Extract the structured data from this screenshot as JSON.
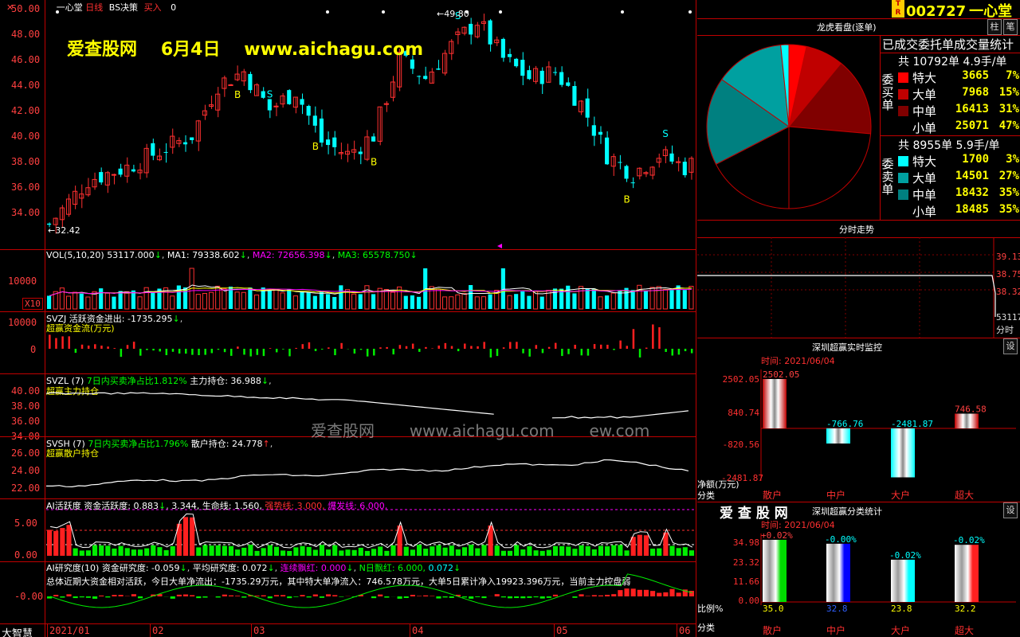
{
  "chart": {
    "stock_name": "一心堂",
    "period": "日线",
    "strategy": "BS决策",
    "signal": "买入",
    "signal_marker": "0",
    "banner_site": "爱查股网",
    "banner_date": "6月4日",
    "banner_url": "www.aichagu.com",
    "high_label": "49.80",
    "low_label": "32.42",
    "price_ticks": [
      "50.00",
      "48.00",
      "46.00",
      "44.00",
      "42.00",
      "40.00",
      "38.00",
      "36.00",
      "34.00"
    ]
  },
  "volume": {
    "header_name": "VOL(5,10,20)",
    "header_vol": "53117.000",
    "ma1": "MA1: 79338.602",
    "ma2": "MA2: 72656.398",
    "ma3": "MA3: 65578.750",
    "tick": "10000",
    "unit": "X10"
  },
  "svzj": {
    "name": "SVZJ",
    "title": "活跃资金进出: -1735.295",
    "subtitle": "超赢资金流(万元)",
    "ticks": [
      "10000",
      "0"
    ]
  },
  "svzl": {
    "name": "SVZL (7)",
    "title": "7日内买卖净占比1.812%",
    "value": "主力持仓: 36.988",
    "subtitle": "超赢主力持仓",
    "ticks": [
      "40.00",
      "38.00",
      "36.00",
      "34.00"
    ]
  },
  "svsh": {
    "name": "SVSH (7)",
    "title": "7日内买卖净占比1.796%",
    "value": "散户持仓: 24.778",
    "subtitle": "超赢散户持仓",
    "ticks": [
      "26.00",
      "24.00",
      "22.00"
    ]
  },
  "ai_active": {
    "title": "AI活跃度",
    "active": "资金活跃度: 0.883",
    "v2": "3.344,",
    "life": "生命线: 1.560,",
    "strong": "强势线: 3.000,",
    "burst": "爆发线: 6.000,",
    "ticks": [
      "5.00",
      "0.00"
    ]
  },
  "ai_research": {
    "title": "AI研究度(10)",
    "research": "资金研究度: -0.059",
    "avg": "平均研究度: 0.072",
    "cont": "连续飘红: 0.000",
    "nday": "N日飘红: 6.000,",
    "last": "0.072",
    "tick": "-0.00",
    "summary": "总体近期大资金相对活跃，今日大单净流出：-1735.29万元，其中特大单净流入：746.578万元，大单5日累计净入19923.396万元，当前主力控盘弱"
  },
  "xaxis": {
    "labels": [
      "2021/01",
      "02",
      "03",
      "04",
      "05",
      "06"
    ],
    "corner": "大智慧"
  },
  "watermark": {
    "site": "爱查股网",
    "url": "www.aichagu.com",
    "tail": "ew.com"
  },
  "right_panel": {
    "code": "002727",
    "name": "一心堂",
    "tab1": "柱",
    "tab2": "笔",
    "lhb_title": "龙虎看盘(逐单)",
    "stats_title": "已成交委托单成交量统计",
    "buy_label": "委买单",
    "sell_label": "委卖单",
    "buy_total": "共 10792单 4.9手/单",
    "sell_total": "共 8955单 5.9手/单",
    "buy_rows": [
      {
        "name": "特大",
        "vol": "3665",
        "pct": "7%",
        "color": "#ff0000"
      },
      {
        "name": "大单",
        "vol": "7968",
        "pct": "15%",
        "color": "#c00000"
      },
      {
        "name": "中单",
        "vol": "16413",
        "pct": "31%",
        "color": "#800000"
      },
      {
        "name": "小单",
        "vol": "25071",
        "pct": "47%",
        "color": "#000000"
      }
    ],
    "sell_rows": [
      {
        "name": "特大",
        "vol": "1700",
        "pct": "3%",
        "color": "#00ffff"
      },
      {
        "name": "大单",
        "vol": "14501",
        "pct": "27%",
        "color": "#00a0a0"
      },
      {
        "name": "中单",
        "vol": "18432",
        "pct": "35%",
        "color": "#008080"
      },
      {
        "name": "小单",
        "vol": "18485",
        "pct": "35%",
        "color": "#000000"
      }
    ],
    "intraday_title": "分时走势",
    "intraday_ticks": [
      "39.13",
      "38.75",
      "38.32",
      "53117",
      "分时"
    ],
    "monitor_title": "深圳超赢实时监控",
    "monitor_btn": "设",
    "monitor_time": "时间: 2021/06/04",
    "monitor_ticks": [
      "2502.05",
      "840.74",
      "-820.56",
      "-2481.87"
    ],
    "monitor_unit": "净额(万元)",
    "monitor_cat": "分类",
    "monitor_bars": [
      {
        "name": "散户",
        "value": "2502.05",
        "num": 2502.05
      },
      {
        "name": "中户",
        "value": "-766.76",
        "num": -766.76
      },
      {
        "name": "大户",
        "value": "-2481.87",
        "num": -2481.87
      },
      {
        "name": "超大",
        "value": "746.58",
        "num": 746.58
      }
    ],
    "class_site": "爱 查 股 网",
    "class_title": "深圳超赢分类统计",
    "class_btn": "设",
    "class_time": "时间: 2021/06/04",
    "class_ticks": [
      "34.98",
      "23.32",
      "11.66",
      "0.00"
    ],
    "class_ratio": "比例%",
    "class_cat": "分类",
    "class_bars": [
      {
        "name": "散户",
        "pct": "+0.02%",
        "value": "35.0",
        "num": 35.0,
        "color": "#00dd00"
      },
      {
        "name": "中户",
        "pct": "-0.00%",
        "value": "32.8",
        "num": 32.8,
        "color": "#0000ff"
      },
      {
        "name": "大户",
        "pct": "-0.02%",
        "value": "23.8",
        "num": 23.8,
        "color": "#00ffff"
      },
      {
        "name": "超大",
        "pct": "-0.02%",
        "value": "32.2",
        "num": 32.2,
        "color": "#ff2020"
      }
    ]
  }
}
